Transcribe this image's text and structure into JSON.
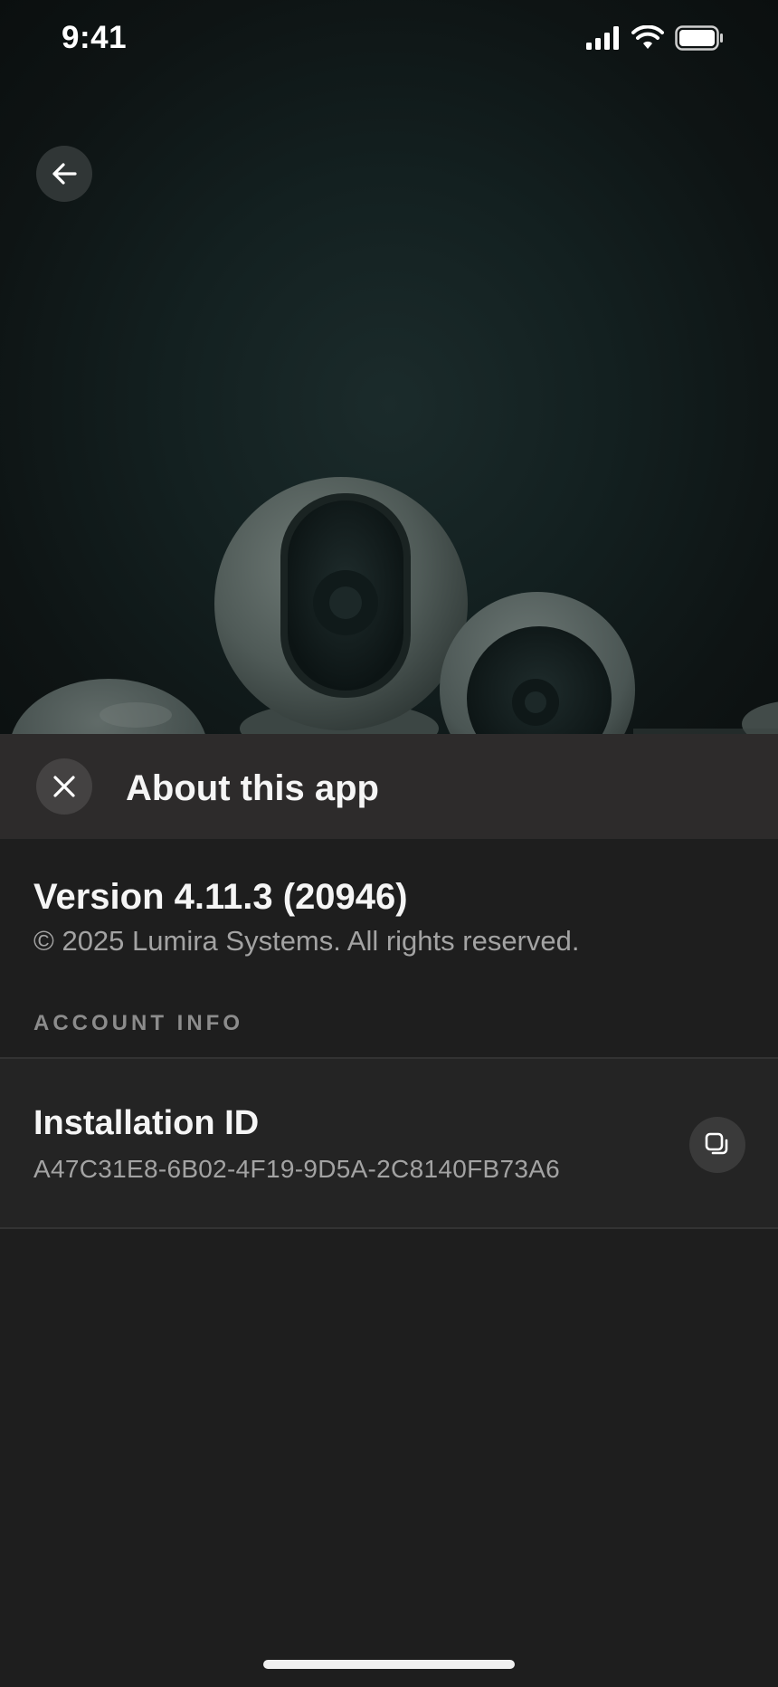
{
  "status_bar": {
    "time": "9:41",
    "icons": [
      "cellular-signal-icon",
      "wifi-icon",
      "battery-icon"
    ]
  },
  "hero": {
    "back_icon": "arrow-left-icon",
    "image": "security-cameras-illustration"
  },
  "sheet": {
    "close_icon": "close-icon",
    "title": "About this app",
    "version": "Version 4.11.3 (20946)",
    "copyright": "© 2025 Lumira Systems. All rights reserved.",
    "section_label": "ACCOUNT INFO",
    "installation": {
      "title": "Installation ID",
      "value": "A47C31E8-6B02-4F19-9D5A-2C8140FB73A6",
      "copy_icon": "copy-icon"
    }
  },
  "colors": {
    "background": "#1e1e1e",
    "header": "#2d2b2b",
    "primary_text": "#f5f5f5",
    "secondary_text": "#a3a3a3",
    "hero_tint": "#132020"
  }
}
